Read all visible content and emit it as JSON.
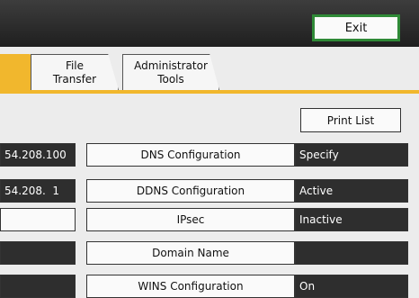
{
  "header": {
    "exit_label": "Exit"
  },
  "tabs": [
    {
      "label": "File\nTransfer"
    },
    {
      "label": "Administrator\nTools"
    }
  ],
  "toolbar": {
    "print_list_label": "Print List"
  },
  "rows": [
    {
      "left": "54.208.100",
      "left_style": "dark",
      "setting": "DNS Configuration",
      "value": "Specify"
    },
    {
      "left": "54.208.  1",
      "left_style": "dark",
      "setting": "DDNS Configuration",
      "value": "Active"
    },
    {
      "left": "",
      "left_style": "light",
      "setting": "IPsec",
      "value": "Inactive"
    },
    {
      "left": "",
      "left_style": "dark",
      "setting": "Domain Name",
      "value": ""
    },
    {
      "left": "",
      "left_style": "dark",
      "setting": "WINS Configuration",
      "value": "On"
    }
  ],
  "colors": {
    "accent": "#f1b72d",
    "exit_border": "#2f8a37",
    "dark_cell": "#2e2e2e"
  }
}
